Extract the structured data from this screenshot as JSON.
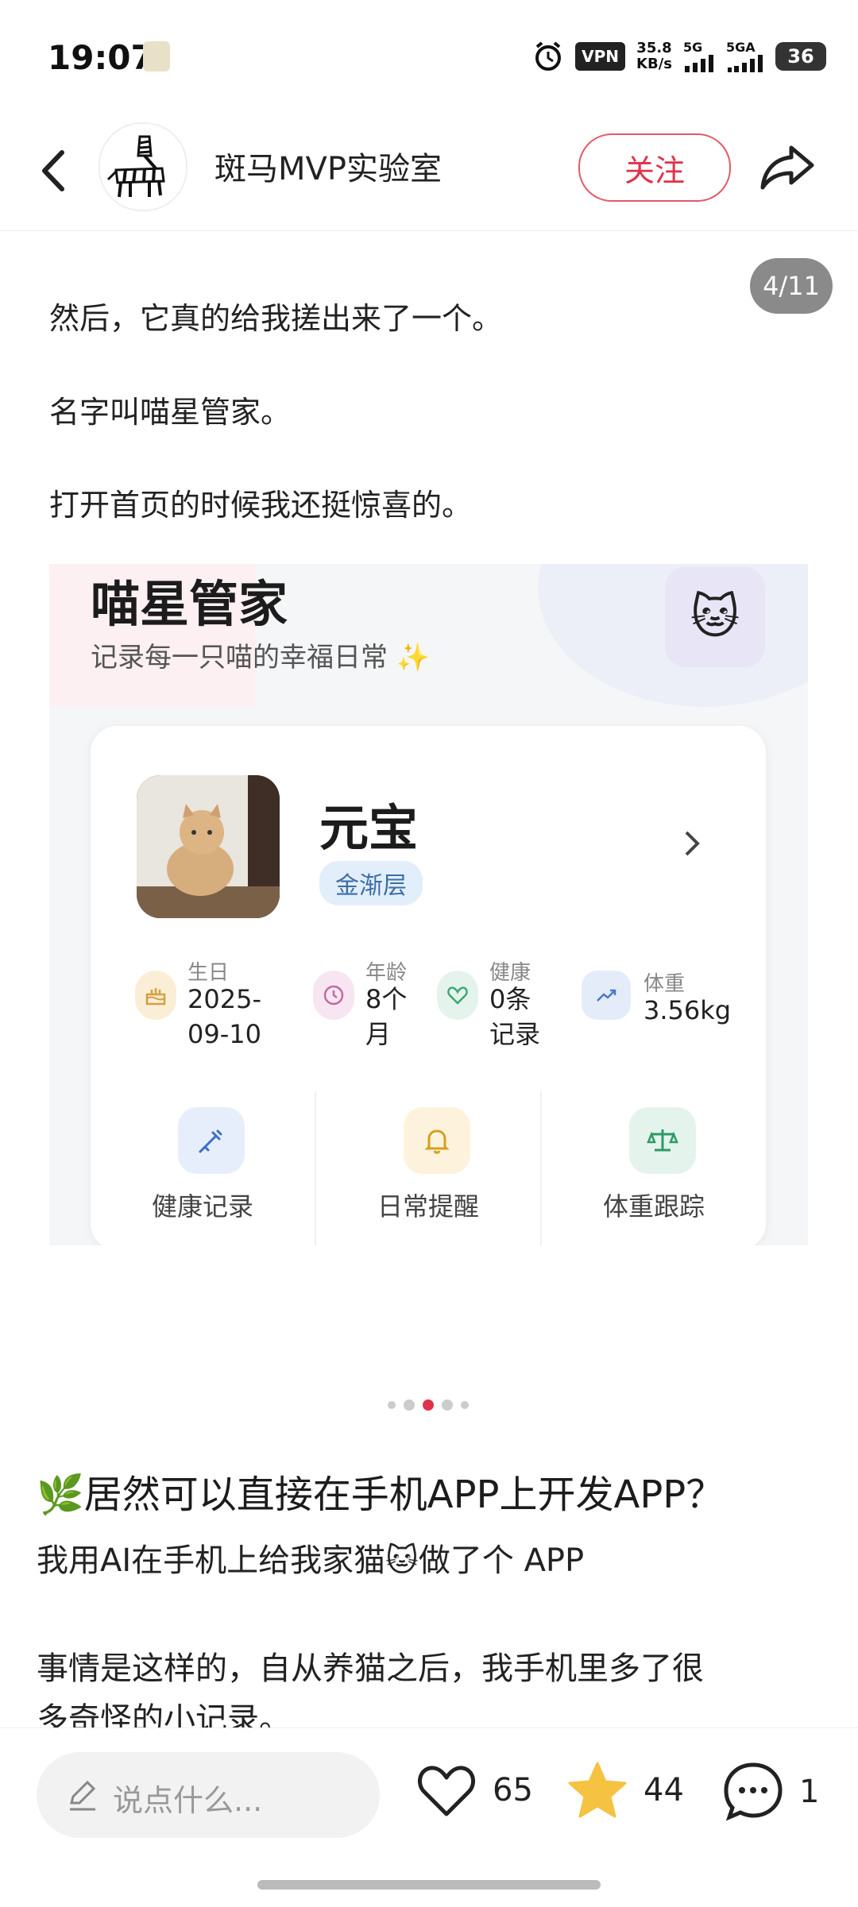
{
  "status_bar": {
    "time": "19:07",
    "vpn": "VPN",
    "speed_value": "35.8",
    "speed_unit": "KB/s",
    "signal_1": "5G",
    "signal_2": "5GA",
    "battery": "36"
  },
  "header": {
    "author_name": "斑马MVP实验室",
    "follow_label": "关注"
  },
  "post": {
    "image_counter": "4/11",
    "paragraphs": [
      "然后，它真的给我搓出来了一个。",
      "名字叫喵星管家。",
      "打开首页的时候我还挺惊喜的。"
    ],
    "title": "🌿居然可以直接在手机APP上开发APP？",
    "body_lines": [
      "我用AI在手机上给我家猫🐱做了个 APP",
      "事情是这样的，自从养猫之后，我手机里多了很",
      "多奇怪的小记录。"
    ],
    "carousel_dots": 5,
    "carousel_active": 3
  },
  "app_screenshot": {
    "app_name": "喵星管家",
    "tagline": "记录每一只喵的幸福日常 ✨",
    "badge_emoji": "🐱",
    "pet_name": "元宝",
    "breed": "金渐层",
    "stats": [
      {
        "label": "生日",
        "value": "2025-\n09-10",
        "icon": "cake-icon",
        "color": "#fbeed7"
      },
      {
        "label": "年龄",
        "value": "8个\n月",
        "icon": "clock-icon",
        "color": "#f7e6f1"
      },
      {
        "label": "健康",
        "value": "0条\n记录",
        "icon": "heart-icon",
        "color": "#e4f4ec"
      },
      {
        "label": "体重",
        "value": "3.56kg",
        "icon": "trend-icon",
        "color": "#e4ecfa"
      }
    ],
    "actions": [
      {
        "label": "健康记录",
        "icon": "syringe-icon",
        "color": "#e6eefb"
      },
      {
        "label": "日常提醒",
        "icon": "bell-icon",
        "color": "#fdf3dc"
      },
      {
        "label": "体重跟踪",
        "icon": "scale-icon",
        "color": "#e4f4ec"
      }
    ]
  },
  "bottom_bar": {
    "comment_placeholder": "说点什么...",
    "likes": "65",
    "stars": "44",
    "comments": "1"
  },
  "colors": {
    "accent": "#e0324a",
    "star": "#f5c242",
    "breed_bg": "#e3eefb"
  }
}
